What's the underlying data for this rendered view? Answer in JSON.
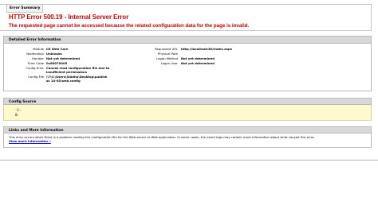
{
  "summary": {
    "tab_label": "Error Summary",
    "title": "HTTP Error 500.19 - Internal Server Error",
    "message": "The requested page cannot be accessed because the related configuration data for the page is invalid."
  },
  "detail": {
    "header": "Detailed Error Information",
    "left": [
      {
        "key": "Module",
        "value": "IIS Web Core"
      },
      {
        "key": "Notification",
        "value": "Unknown"
      },
      {
        "key": "Handler",
        "value": "Not yet determined"
      },
      {
        "key": "Error Code",
        "value": "0x80070005"
      },
      {
        "key": "Config Error",
        "value": "Cannot read configuration file due to insufficient permissions"
      },
      {
        "key": "Config File",
        "value": "\\\\?\\C:\\Users\\Siddhu\\Desktop\\publish ss 14-03\\web.config"
      }
    ],
    "right": [
      {
        "key": "Requested URL",
        "value": "http://localhost:80/index.aspx"
      },
      {
        "key": "Physical Path",
        "value": ""
      },
      {
        "key": "Logon Method",
        "value": "Not yet determined"
      },
      {
        "key": "Logon User",
        "value": "Not yet determined"
      }
    ]
  },
  "config_source": {
    "header": "Config Source",
    "lines": [
      "-1:",
      "0:"
    ]
  },
  "links": {
    "header": "Links and More Information",
    "text": "This error occurs when there is a problem reading the configuration file for the Web server or Web application. In some cases, the event logs may contain more information about what caused this error.",
    "more_link": "View more information »"
  }
}
